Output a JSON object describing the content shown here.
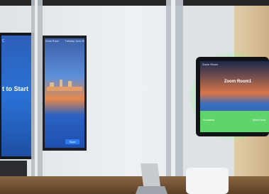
{
  "scene": {
    "description_type": "photo",
    "colors": {
      "wall": "#e9ecef",
      "wall_shadow": "#c9ced3",
      "wood_panel": "#d9c39e",
      "floor_table": "#7a5a3c",
      "screen_frame": "#1d1f23",
      "tablet_green": "#5fd46a",
      "bay_blue": "#2f6fd0",
      "city_orange": "#e8894a"
    }
  },
  "left_tv": {
    "text_line1": "t to Start",
    "text_small": "C"
  },
  "center_display": {
    "header_left": "Zoom Room",
    "header_right": "Tuesday, June 25",
    "button_label": "Start"
  },
  "tablet": {
    "header": "Zoom Room",
    "title": "Zoom Room1",
    "bottom_left": "Available",
    "bottom_right": "Meet Now"
  }
}
